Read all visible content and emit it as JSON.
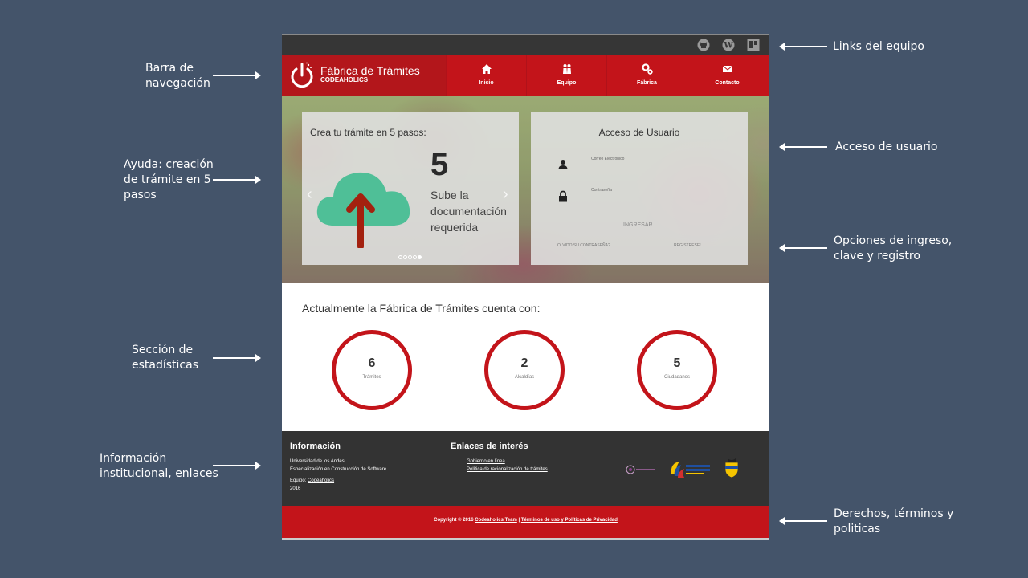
{
  "annotations": {
    "links_equipo": "Links del equipo",
    "barra_navegacion": "Barra de\nnavegación",
    "acceso_usuario": "Acceso de usuario",
    "ayuda": "Ayuda: creación\nde trámite en 5\npasos",
    "opciones": "Opciones de ingreso,\nclave y registro",
    "estadisticas": "Sección de\nestadísticas",
    "info": "Información\ninstitucional, enlaces",
    "derechos": "Derechos, términos y\npoliticas"
  },
  "topbar": {
    "icons": [
      "github-icon",
      "wordpress-icon",
      "trello-icon"
    ]
  },
  "brand": {
    "title": "Fábrica de Trámites",
    "subtitle": "CODEAHOLICS"
  },
  "nav": {
    "items": [
      {
        "label": "Inicio",
        "icon": "home-icon"
      },
      {
        "label": "Equipo",
        "icon": "team-icon"
      },
      {
        "label": "Fábrica",
        "icon": "gears-icon"
      },
      {
        "label": "Contacto",
        "icon": "envelope-icon"
      }
    ]
  },
  "help": {
    "title": "Crea tu trámite en 5 pasos:",
    "step_number": "5",
    "step_text": "Sube la documentación requerida",
    "slide_count": 5,
    "active_slide": 5
  },
  "login": {
    "title": "Acceso de Usuario",
    "email_label": "Correo Electrónico",
    "password_label": "Contraseña",
    "submit": "INGRESAR",
    "forgot": "OLVIDO SU CONTRASEÑA?",
    "register": "REGISTRESE!"
  },
  "stats": {
    "title": "Actualmente la Fábrica de Trámites cuenta con:",
    "items": [
      {
        "value": "6",
        "label": "Trámites"
      },
      {
        "value": "2",
        "label": "Alcaldías"
      },
      {
        "value": "5",
        "label": "Ciudadanos"
      }
    ]
  },
  "footer": {
    "info_title": "Información",
    "university": "Universidad de los Andes",
    "program": "Especialización en Construcción de Software",
    "team_label": "Equipo: ",
    "team_link": "Codeaholics",
    "year": "2016",
    "links_title": "Enlaces de interés",
    "links": [
      "Gobierno en línea",
      "Política de racionalización de trámites"
    ]
  },
  "copyright": {
    "prefix": "Copyright © 2016 ",
    "team": "Codeaholics Team",
    "separator": " | ",
    "terms": "Términos de uso y Políticas de Privacidad"
  },
  "colors": {
    "background": "#44546a",
    "brand_red": "#c3141a",
    "footer_dark": "#333333",
    "cloud": "#4fbf97"
  }
}
